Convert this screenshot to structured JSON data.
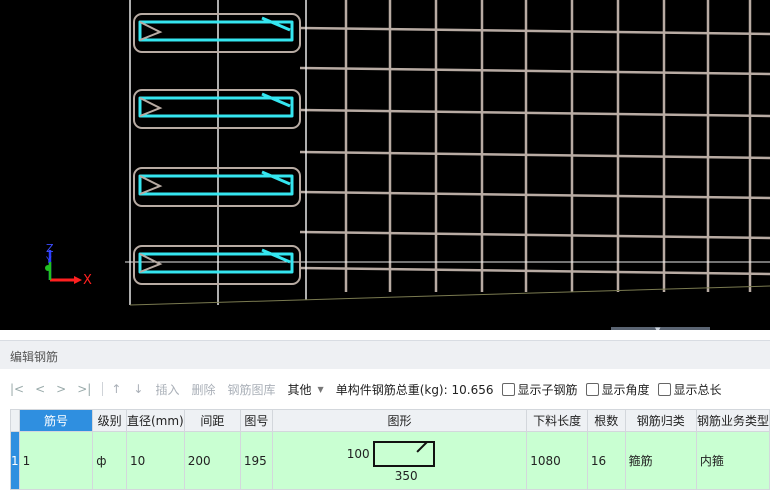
{
  "viewport": {
    "axis_labels": {
      "z": "Z",
      "y": "Y",
      "x": "X"
    },
    "colors": {
      "background": "#000000",
      "rebar": "#b8aba3",
      "stirrup": "#35e6f0",
      "edge": "#e8e8e8"
    }
  },
  "panel": {
    "title": "编辑钢筋"
  },
  "toolbar": {
    "nav": [
      "|<",
      "<",
      ">",
      ">|"
    ],
    "up_arrow": "↑",
    "down_arrow": "↓",
    "insert": "插入",
    "delete": "删除",
    "library": "钢筋图库",
    "other": "其他",
    "total_weight_label": "单构件钢筋总重(kg):",
    "total_weight_value": "10.656",
    "checkboxes": [
      "显示子钢筋",
      "显示角度",
      "显示总长"
    ]
  },
  "table": {
    "headers": [
      "筋号",
      "级别",
      "直径(mm)",
      "间距",
      "图号",
      "图形",
      "下料长度",
      "根数",
      "钢筋归类",
      "钢筋业务类型"
    ],
    "rows": [
      {
        "index": "1",
        "bar_no": "1",
        "grade": "ф",
        "diameter": "10",
        "spacing": "200",
        "figure_no": "195",
        "shape_dim_a": "100",
        "shape_dim_b": "350",
        "cut_length": "1080",
        "count": "16",
        "category": "箍筋",
        "business_type": "内箍"
      }
    ]
  }
}
